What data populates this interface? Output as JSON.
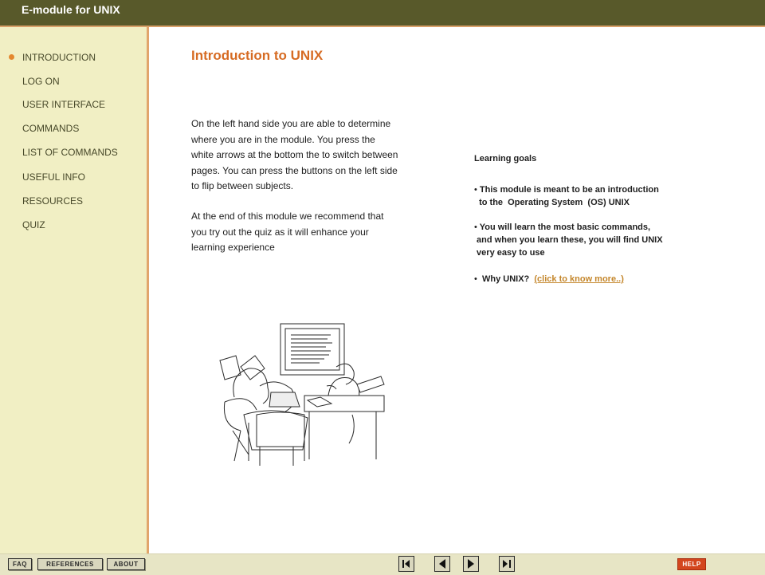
{
  "app": {
    "title": "E-module for UNIX"
  },
  "sidebar": {
    "items": [
      {
        "label": "INTRODUCTION",
        "active": true
      },
      {
        "label": "LOG ON"
      },
      {
        "label": "USER INTERFACE"
      },
      {
        "label": "COMMANDS"
      },
      {
        "label": "LIST OF COMMANDS"
      },
      {
        "label": "USEFUL INFO"
      },
      {
        "label": "RESOURCES"
      },
      {
        "label": "QUIZ"
      }
    ]
  },
  "main": {
    "title": "Introduction to UNIX",
    "paragraph1": [
      "On the left hand side you are able to determine",
      "where  you are in the module. You press the",
      "white arrows at the bottom the to switch between",
      "pages. You can press the buttons on the left side",
      "to flip between subjects."
    ],
    "paragraph2": [
      "At the end of this module we recommend that",
      "you try out the quiz as it will enhance your",
      "learning experience"
    ],
    "goals": {
      "heading": "Learning goals",
      "items": [
        {
          "bullet": "•",
          "lines": [
            "This module is meant to be an introduction",
            "  to the  Operating System  (OS) UNIX"
          ]
        },
        {
          "bullet": "•",
          "lines": [
            "You will learn the most basic commands,",
            " and when you learn these, you will find UNIX",
            " very easy to use"
          ]
        }
      ],
      "why": {
        "bullet": "•",
        "text": " Why UNIX?",
        "link": "(click to know more..)"
      }
    }
  },
  "footer": {
    "faq": "FAQ",
    "references": "REFERENCES",
    "about": "ABOUT",
    "help": "HELP",
    "nav": [
      "first-page",
      "previous-page",
      "next-page",
      "last-page"
    ]
  },
  "colors": {
    "topbar": "#58592a",
    "sidebar": "#f1efc4",
    "accent": "#d66b23",
    "link": "#c4862b",
    "help": "#d3461e"
  }
}
